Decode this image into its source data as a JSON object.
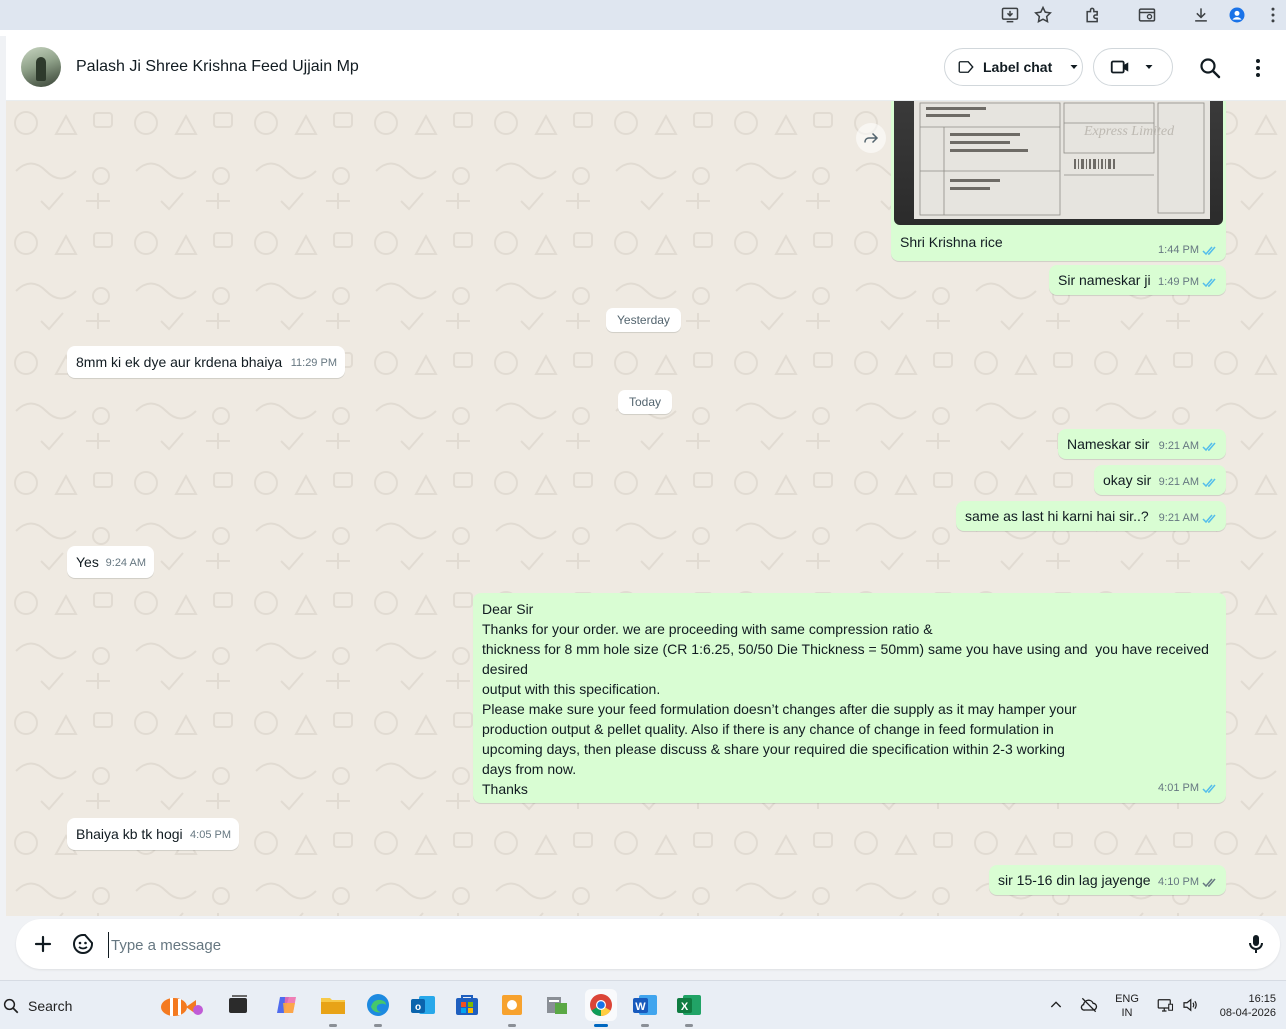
{
  "chat": {
    "contact_name": "Palash Ji Shree Krishna Feed Ujjain Mp",
    "label_chat": "Label chat"
  },
  "messages": {
    "image_caption": "Shri Krishna rice",
    "image_time": "1:44 PM",
    "m1_text": "Sir nameskar ji",
    "m1_time": "1:49 PM",
    "date_yesterday": "Yesterday",
    "m2_text": "8mm ki ek dye aur krdena bhaiya",
    "m2_time": "11:29 PM",
    "date_today": "Today",
    "m3_text": "Nameskar sir",
    "m3_time": "9:21 AM",
    "m4_text": "okay sir",
    "m4_time": "9:21 AM",
    "m5_text": "same as last hi karni hai sir..?",
    "m5_time": "9:21 AM",
    "m6_text": "Yes",
    "m6_time": "9:24 AM",
    "m7_lines": [
      "Dear Sir",
      "Thanks for your order. we are proceeding with same compression ratio &",
      "thickness for 8 mm hole size (CR 1:6.25, 50/50 Die Thickness = 50mm) same you have using and  you have received desired",
      "output with this specification.",
      "Please make sure your feed formulation doesn’t changes after die supply as it may hamper your",
      "production output & pellet quality. Also if there is any chance of change in feed formulation in",
      "upcoming days, then please discuss & share your required die specification within 2-3 working",
      "days from now.",
      "Thanks"
    ],
    "m7_time": "4:01 PM",
    "m8_text": "Bhaiya kb tk hogi",
    "m8_time": "4:05 PM",
    "m9_text": "sir 15-16 din lag jayenge",
    "m9_time": "4:10 PM"
  },
  "compose": {
    "placeholder": "Type a message"
  },
  "taskbar": {
    "search_label": "Search",
    "lang_top": "ENG",
    "lang_bottom": "IN",
    "time": "16:15",
    "date": "08-04-2026"
  },
  "colors": {
    "outgoing_bubble": "#d9fdd3",
    "incoming_bubble": "#ffffff",
    "chat_background": "#efeae2",
    "read_tick": "#53bdeb"
  }
}
